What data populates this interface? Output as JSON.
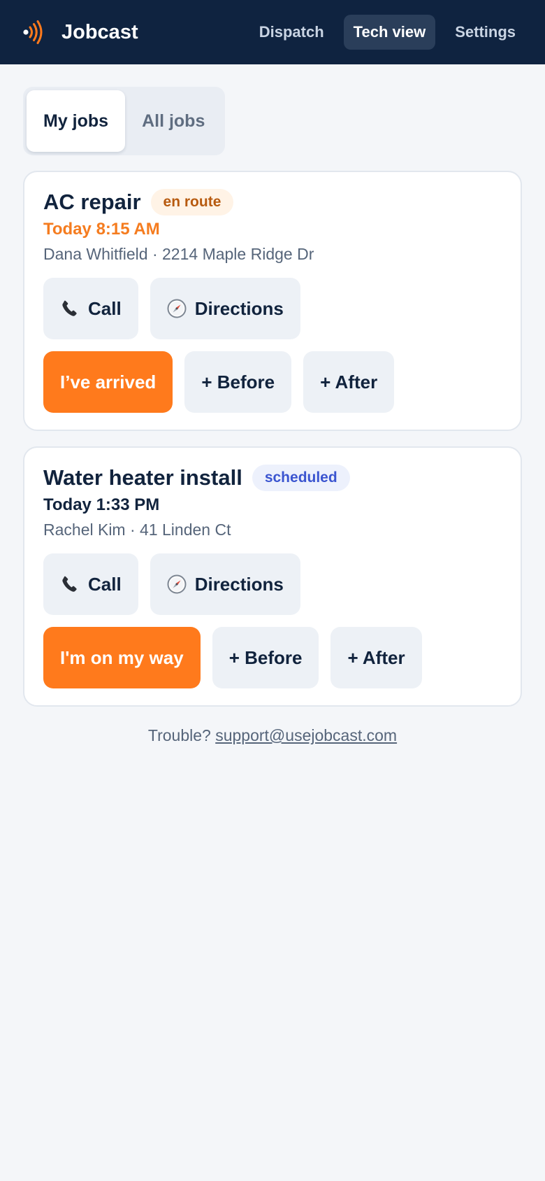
{
  "app": {
    "name": "Jobcast",
    "logo_icon": "broadcast-icon"
  },
  "nav": {
    "items": [
      {
        "label": "Dispatch",
        "active": false
      },
      {
        "label": "Tech view",
        "active": true
      },
      {
        "label": "Settings",
        "active": false
      }
    ]
  },
  "tabs": {
    "items": [
      {
        "label": "My jobs",
        "active": true
      },
      {
        "label": "All jobs",
        "active": false
      }
    ]
  },
  "jobs": [
    {
      "title": "AC repair",
      "status": "en route",
      "time": "Today 8:15 AM",
      "meta": "Dana Whitfield · 2214 Maple Ridge Dr",
      "call_label": "Call",
      "call_icon": "phone-icon",
      "directions_label": "Directions",
      "directions_icon": "compass-icon",
      "primary_label": "I’ve arrived",
      "before_label": "+ Before",
      "after_label": "+ After"
    },
    {
      "title": "Water heater install",
      "status": "scheduled",
      "time": "Today 1:33 PM",
      "meta": "Rachel Kim · 41 Linden Ct",
      "call_label": "Call",
      "call_icon": "phone-icon",
      "directions_label": "Directions",
      "directions_icon": "compass-icon",
      "primary_label": "I'm on my way",
      "before_label": "+ Before",
      "after_label": "+ After"
    }
  ],
  "support": {
    "prefix": "Trouble?",
    "email": "support@usejobcast.com"
  },
  "colors": {
    "header_bg": "#0f2340",
    "accent": "#ff7a1c",
    "enroute_badge_text": "#b75a0f",
    "scheduled_badge_text": "#3b55d0",
    "page_bg": "#f4f6f9"
  }
}
